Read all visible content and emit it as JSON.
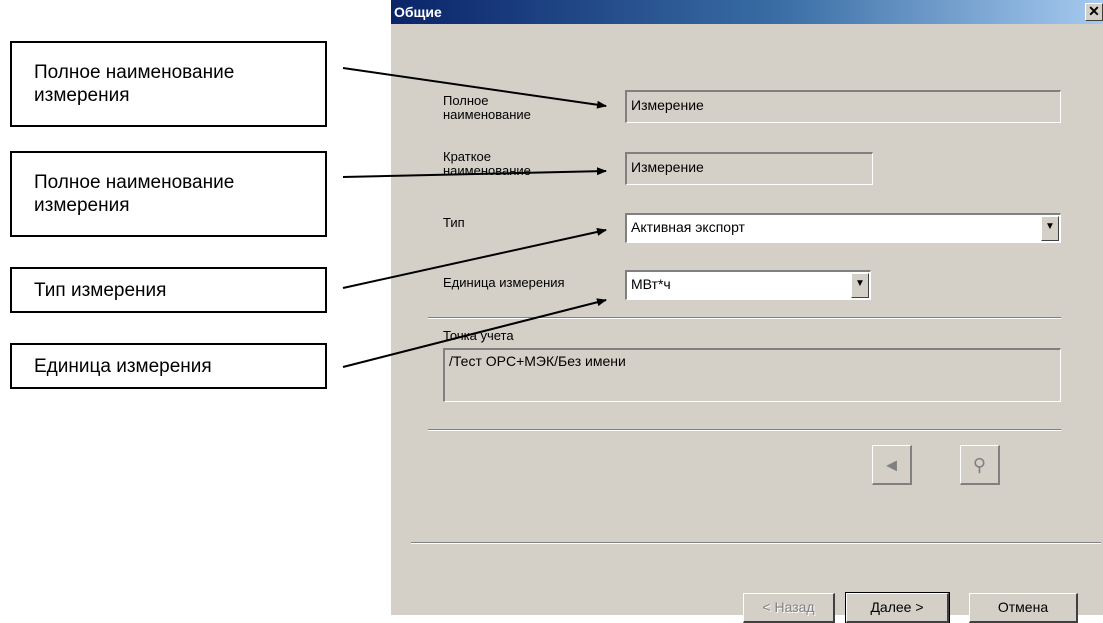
{
  "callouts": [
    {
      "text": "Полное наименование измерения"
    },
    {
      "text": "Полное наименование измерения"
    },
    {
      "text": "Тип измерения"
    },
    {
      "text": "Единица измерения"
    }
  ],
  "dialog": {
    "title": "Общие",
    "close_symbol": "✕",
    "full_name": {
      "label": "Полное наименование",
      "value": "Измерение"
    },
    "short_name": {
      "label": "Краткое наименование",
      "value": "Измерение"
    },
    "type": {
      "label": "Тип",
      "value": "Активная экспорт"
    },
    "unit": {
      "label": "Единица измерения",
      "value": "МВт*ч"
    },
    "metering_point": {
      "label": "Точка учета",
      "value": "/Тест OPC+МЭК/Без имени"
    },
    "icons": {
      "left": "speaker-icon",
      "right": "tool-icon"
    },
    "buttons": {
      "back": "< Назад",
      "next": "Далее >",
      "cancel": "Отмена"
    }
  },
  "colors": {
    "dialog_bg": "#d4d0c8",
    "title_gradient_start": "#0a246a",
    "title_gradient_end": "#a6caf0"
  }
}
